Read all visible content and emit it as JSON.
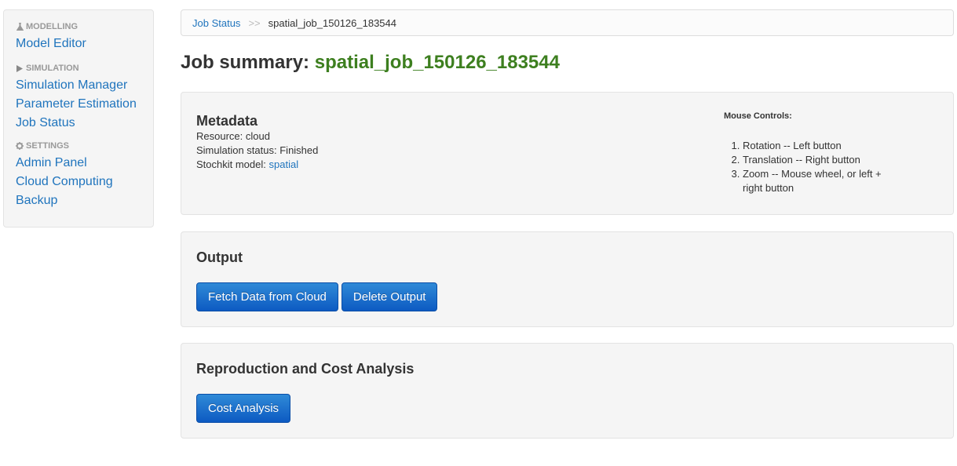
{
  "sidebar": {
    "sections": [
      {
        "header": "MODELLING",
        "icon": "flask-icon",
        "items": [
          "Model Editor"
        ]
      },
      {
        "header": "SIMULATION",
        "icon": "play-icon",
        "items": [
          "Simulation Manager",
          "Parameter Estimation",
          "Job Status"
        ]
      },
      {
        "header": "SETTINGS",
        "icon": "gear-icon",
        "items": [
          "Admin Panel",
          "Cloud Computing",
          "Backup"
        ]
      }
    ]
  },
  "breadcrumb": {
    "link": "Job Status",
    "divider": ">>",
    "current": "spatial_job_150126_183544"
  },
  "title": {
    "prefix": "Job summary:",
    "job_name": "spatial_job_150126_183544"
  },
  "metadata": {
    "heading": "Metadata",
    "resource_label": "Resource:",
    "resource_value": "cloud",
    "status_label": "Simulation status:",
    "status_value": "Finished",
    "model_label": "Stochkit model:",
    "model_value": "spatial"
  },
  "mouse_controls": {
    "heading": "Mouse Controls:",
    "items": [
      "Rotation -- Left button",
      "Translation -- Right button",
      "Zoom -- Mouse wheel, or left + right button"
    ]
  },
  "output": {
    "heading": "Output",
    "fetch_button": "Fetch Data from Cloud",
    "delete_button": "Delete Output"
  },
  "cost": {
    "heading": "Reproduction and Cost Analysis",
    "button": "Cost Analysis"
  },
  "colors": {
    "link": "#1f74bd",
    "job_name": "#3d7f1f",
    "button": "#0d5ac2"
  }
}
